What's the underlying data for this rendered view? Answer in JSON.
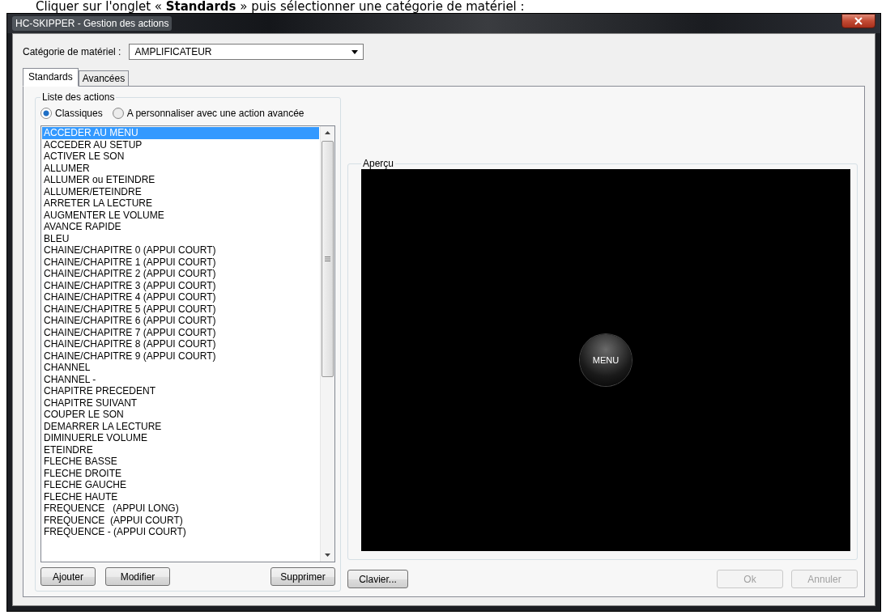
{
  "document_caption": "Cliquer sur l'onglet « **Standards** » puis sélectionner une catégorie de matériel :",
  "window": {
    "title": "HC-SKIPPER - Gestion des actions"
  },
  "category": {
    "label": "Catégorie de matériel :",
    "value": "AMPLIFICATEUR"
  },
  "tabs": [
    {
      "label": "Standards",
      "selected": true
    },
    {
      "label": "Avancées",
      "selected": false
    }
  ],
  "actions_group": {
    "title": "Liste des actions",
    "radios": [
      {
        "label": "Classiques",
        "selected": true
      },
      {
        "label": "A personnaliser avec une action avancée",
        "selected": false
      }
    ],
    "items": [
      {
        "label": "ACCEDER AU MENU",
        "selected": true
      },
      {
        "label": "ACCEDER AU SETUP",
        "selected": false
      },
      {
        "label": "ACTIVER LE SON",
        "selected": false
      },
      {
        "label": "ALLUMER",
        "selected": false
      },
      {
        "label": "ALLUMER ou ETEINDRE",
        "selected": false
      },
      {
        "label": "ALLUMER/ETEINDRE",
        "selected": false
      },
      {
        "label": "ARRETER LA LECTURE",
        "selected": false
      },
      {
        "label": "AUGMENTER LE VOLUME",
        "selected": false
      },
      {
        "label": "AVANCE RAPIDE",
        "selected": false
      },
      {
        "label": "BLEU",
        "selected": false
      },
      {
        "label": "CHAINE/CHAPITRE 0 (APPUI COURT)",
        "selected": false
      },
      {
        "label": "CHAINE/CHAPITRE 1 (APPUI COURT)",
        "selected": false
      },
      {
        "label": "CHAINE/CHAPITRE 2 (APPUI COURT)",
        "selected": false
      },
      {
        "label": "CHAINE/CHAPITRE 3 (APPUI COURT)",
        "selected": false
      },
      {
        "label": "CHAINE/CHAPITRE 4 (APPUI COURT)",
        "selected": false
      },
      {
        "label": "CHAINE/CHAPITRE 5 (APPUI COURT)",
        "selected": false
      },
      {
        "label": "CHAINE/CHAPITRE 6 (APPUI COURT)",
        "selected": false
      },
      {
        "label": "CHAINE/CHAPITRE 7 (APPUI COURT)",
        "selected": false
      },
      {
        "label": "CHAINE/CHAPITRE 8 (APPUI COURT)",
        "selected": false
      },
      {
        "label": "CHAINE/CHAPITRE 9 (APPUI COURT)",
        "selected": false
      },
      {
        "label": "CHANNEL",
        "selected": false
      },
      {
        "label": "CHANNEL -",
        "selected": false
      },
      {
        "label": "CHAPITRE PRECEDENT",
        "selected": false
      },
      {
        "label": "CHAPITRE SUIVANT",
        "selected": false
      },
      {
        "label": "COUPER LE SON",
        "selected": false
      },
      {
        "label": "DEMARRER LA LECTURE",
        "selected": false
      },
      {
        "label": "DIMINUERLE VOLUME",
        "selected": false
      },
      {
        "label": "ETEINDRE",
        "selected": false
      },
      {
        "label": "FLECHE BASSE",
        "selected": false
      },
      {
        "label": "FLECHE DROITE",
        "selected": false
      },
      {
        "label": "FLECHE GAUCHE",
        "selected": false
      },
      {
        "label": "FLECHE HAUTE",
        "selected": false
      },
      {
        "label": "FREQUENCE   (APPUI LONG)",
        "selected": false
      },
      {
        "label": "FREQUENCE  (APPUI COURT)",
        "selected": false
      },
      {
        "label": "FREQUENCE - (APPUI COURT)",
        "selected": false
      }
    ],
    "buttons": [
      {
        "label": "Ajouter",
        "disabled": false
      },
      {
        "label": "Modifier",
        "disabled": false
      },
      {
        "label": "Supprimer",
        "disabled": false
      }
    ]
  },
  "preview": {
    "title": "Aperçu",
    "remote_button": "MENU"
  },
  "footer_buttons": [
    {
      "label": "Clavier...",
      "disabled": false
    },
    {
      "label": "Ok",
      "disabled": true
    },
    {
      "label": "Annuler",
      "disabled": true
    }
  ]
}
